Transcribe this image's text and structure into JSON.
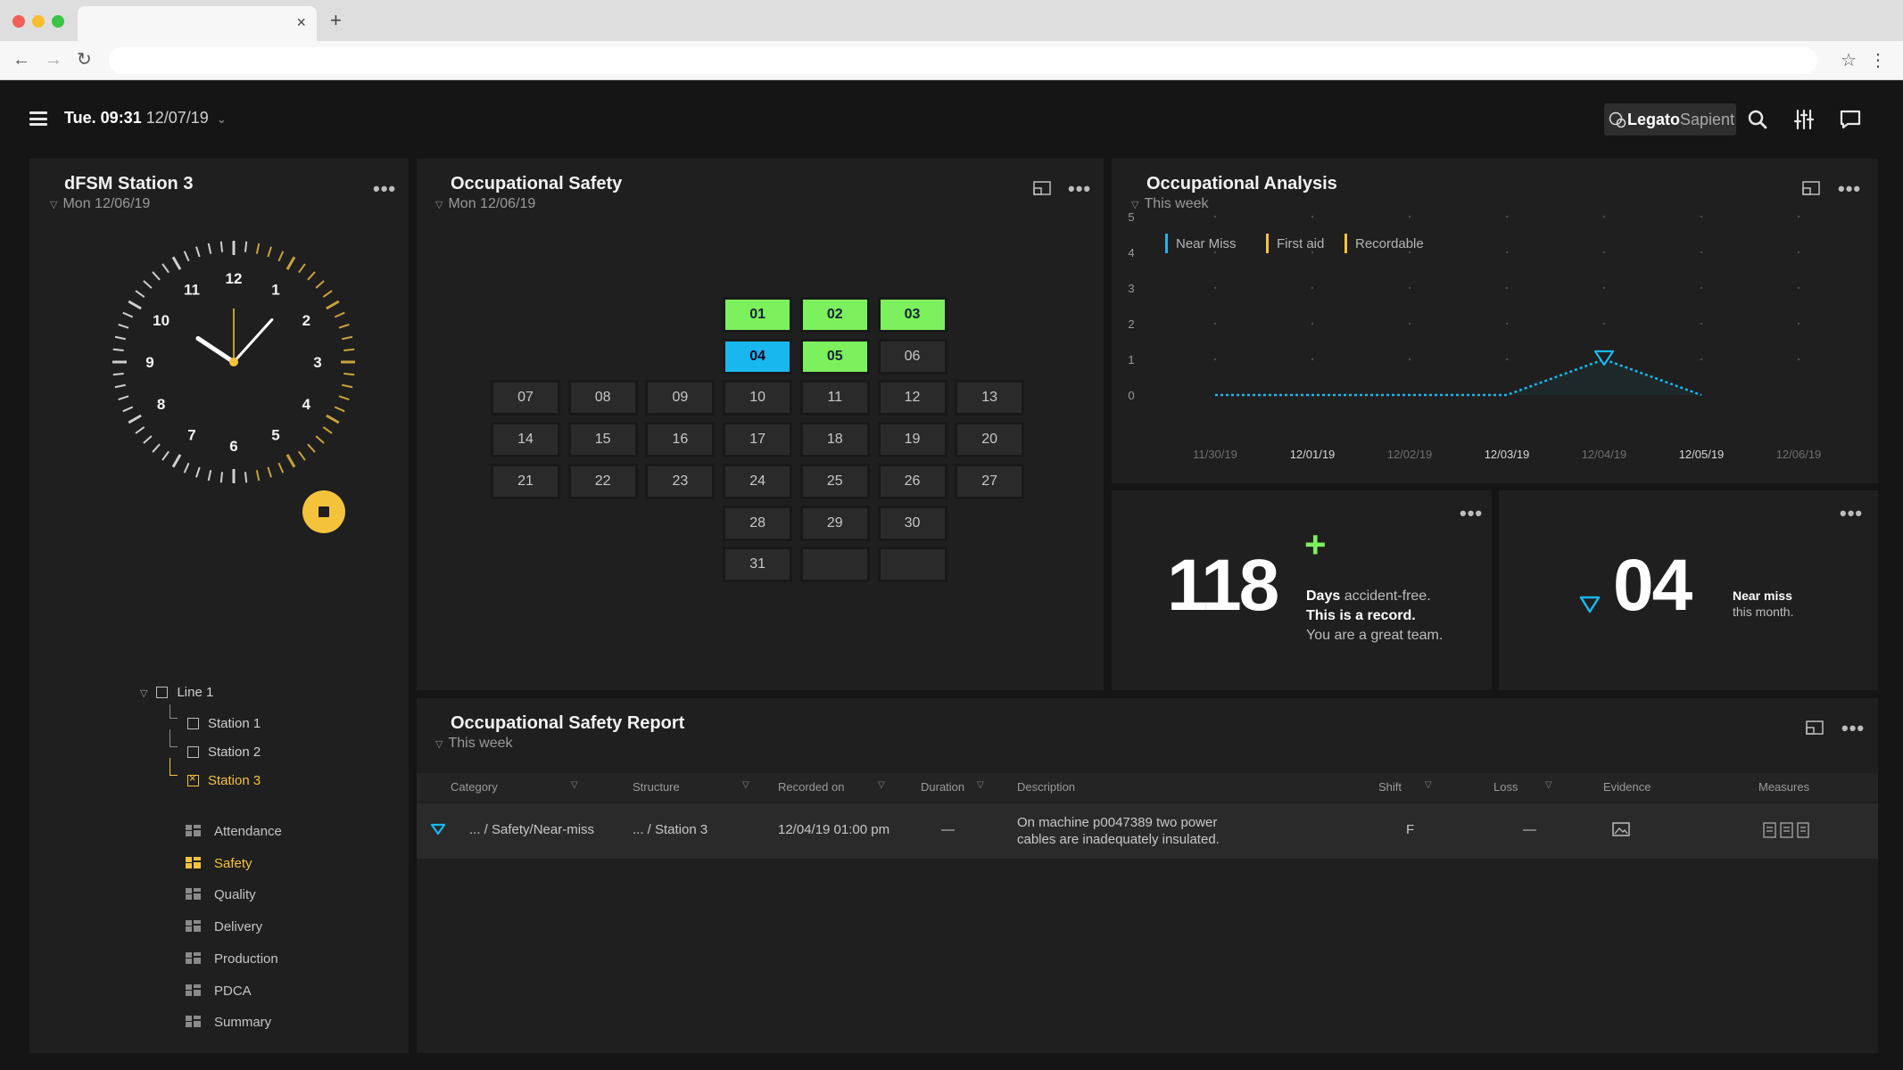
{
  "browser": {
    "tab_close": "×",
    "new_tab": "+",
    "nav_back": "←",
    "nav_forward": "→",
    "nav_reload": "↻",
    "bookmark": "☆",
    "menu": "⋮"
  },
  "topbar": {
    "time": "Tue. 09:31",
    "date": "12/07/19",
    "chevron": "⌄",
    "brand_main": "Legato",
    "brand_sub": "Sapient",
    "icons": [
      "menu-icon",
      "search-icon",
      "filter-sliders-icon",
      "chat-icon"
    ]
  },
  "station_panel": {
    "title": "dFSM Station 3",
    "date": "Mon 12/06/19",
    "more": "•••",
    "clock": {
      "hour_labels": [
        "12",
        "1",
        "2",
        "3",
        "4",
        "5",
        "6",
        "7",
        "8",
        "9",
        "10",
        "11"
      ],
      "time": "10:07"
    },
    "tree": {
      "root": "Line 1",
      "children": [
        "Station 1",
        "Station 2",
        "Station 3"
      ],
      "active_child": "Station 3"
    },
    "menu": [
      "Attendance",
      "Safety",
      "Quality",
      "Delivery",
      "Production",
      "PDCA",
      "Summary"
    ],
    "active_menu": "Safety",
    "accent_color": "#f5c33b"
  },
  "safety_panel": {
    "title": "Occupational Safety",
    "date": "Mon 12/06/19",
    "more": "•••",
    "days": [
      "01",
      "02",
      "03",
      "04",
      "05",
      "06",
      "07",
      "08",
      "09",
      "10",
      "11",
      "12",
      "13",
      "14",
      "15",
      "16",
      "17",
      "18",
      "19",
      "20",
      "21",
      "22",
      "23",
      "24",
      "25",
      "26",
      "27",
      "28",
      "29",
      "30",
      "31"
    ],
    "status": {
      "01": "green",
      "02": "green",
      "03": "green",
      "04": "blue",
      "05": "green"
    },
    "colors": {
      "green": "#7df05d",
      "blue": "#18b8ee"
    }
  },
  "analysis_panel": {
    "title": "Occupational Analysis",
    "period": "This week",
    "more": "•••",
    "legend": [
      {
        "label": "Near Miss",
        "color": "#18b8ee"
      },
      {
        "label": "First aid",
        "color": "#f5c33b"
      },
      {
        "label": "Recordable",
        "color": "#f5c33b"
      }
    ]
  },
  "chart_data": {
    "type": "line",
    "title": "Occupational Analysis",
    "x": [
      "11/30/19",
      "12/01/19",
      "12/02/19",
      "12/03/19",
      "12/04/19",
      "12/05/19",
      "12/06/19"
    ],
    "series": [
      {
        "name": "Near Miss",
        "values": [
          0,
          0,
          0,
          0,
          1,
          0,
          null
        ],
        "color": "#18b8ee"
      }
    ],
    "ylim": [
      0,
      5
    ],
    "yticks": [
      "0",
      "1",
      "2",
      "3",
      "4",
      "5"
    ],
    "grid": true,
    "legend_position": "top-left"
  },
  "kpi_accident_free": {
    "value": "118",
    "plus": "+",
    "line1_bold": "Days",
    "line1": " accident-free.",
    "line2": "This is a record.",
    "line3": "You are a great team.",
    "more": "•••"
  },
  "kpi_near_miss": {
    "value": "04",
    "label_bold": "Near miss",
    "label": "this month.",
    "more": "•••"
  },
  "report_panel": {
    "title": "Occupational Safety Report",
    "period": "This week",
    "more": "•••",
    "columns": [
      "Category",
      "Structure",
      "Recorded on",
      "Duration",
      "Description",
      "Shift",
      "Loss",
      "Evidence",
      "Measures"
    ],
    "rows": [
      {
        "category": "... / Safety/Near-miss",
        "structure": "... / Station 3",
        "recorded_on": "12/04/19 01:00 pm",
        "duration": "—",
        "description_line1": "On machine p0047389 two power",
        "description_line2": "cables are inadequately insulated.",
        "shift": "F",
        "loss": "—",
        "evidence": "image-icon",
        "measures": "document-icons"
      }
    ]
  }
}
